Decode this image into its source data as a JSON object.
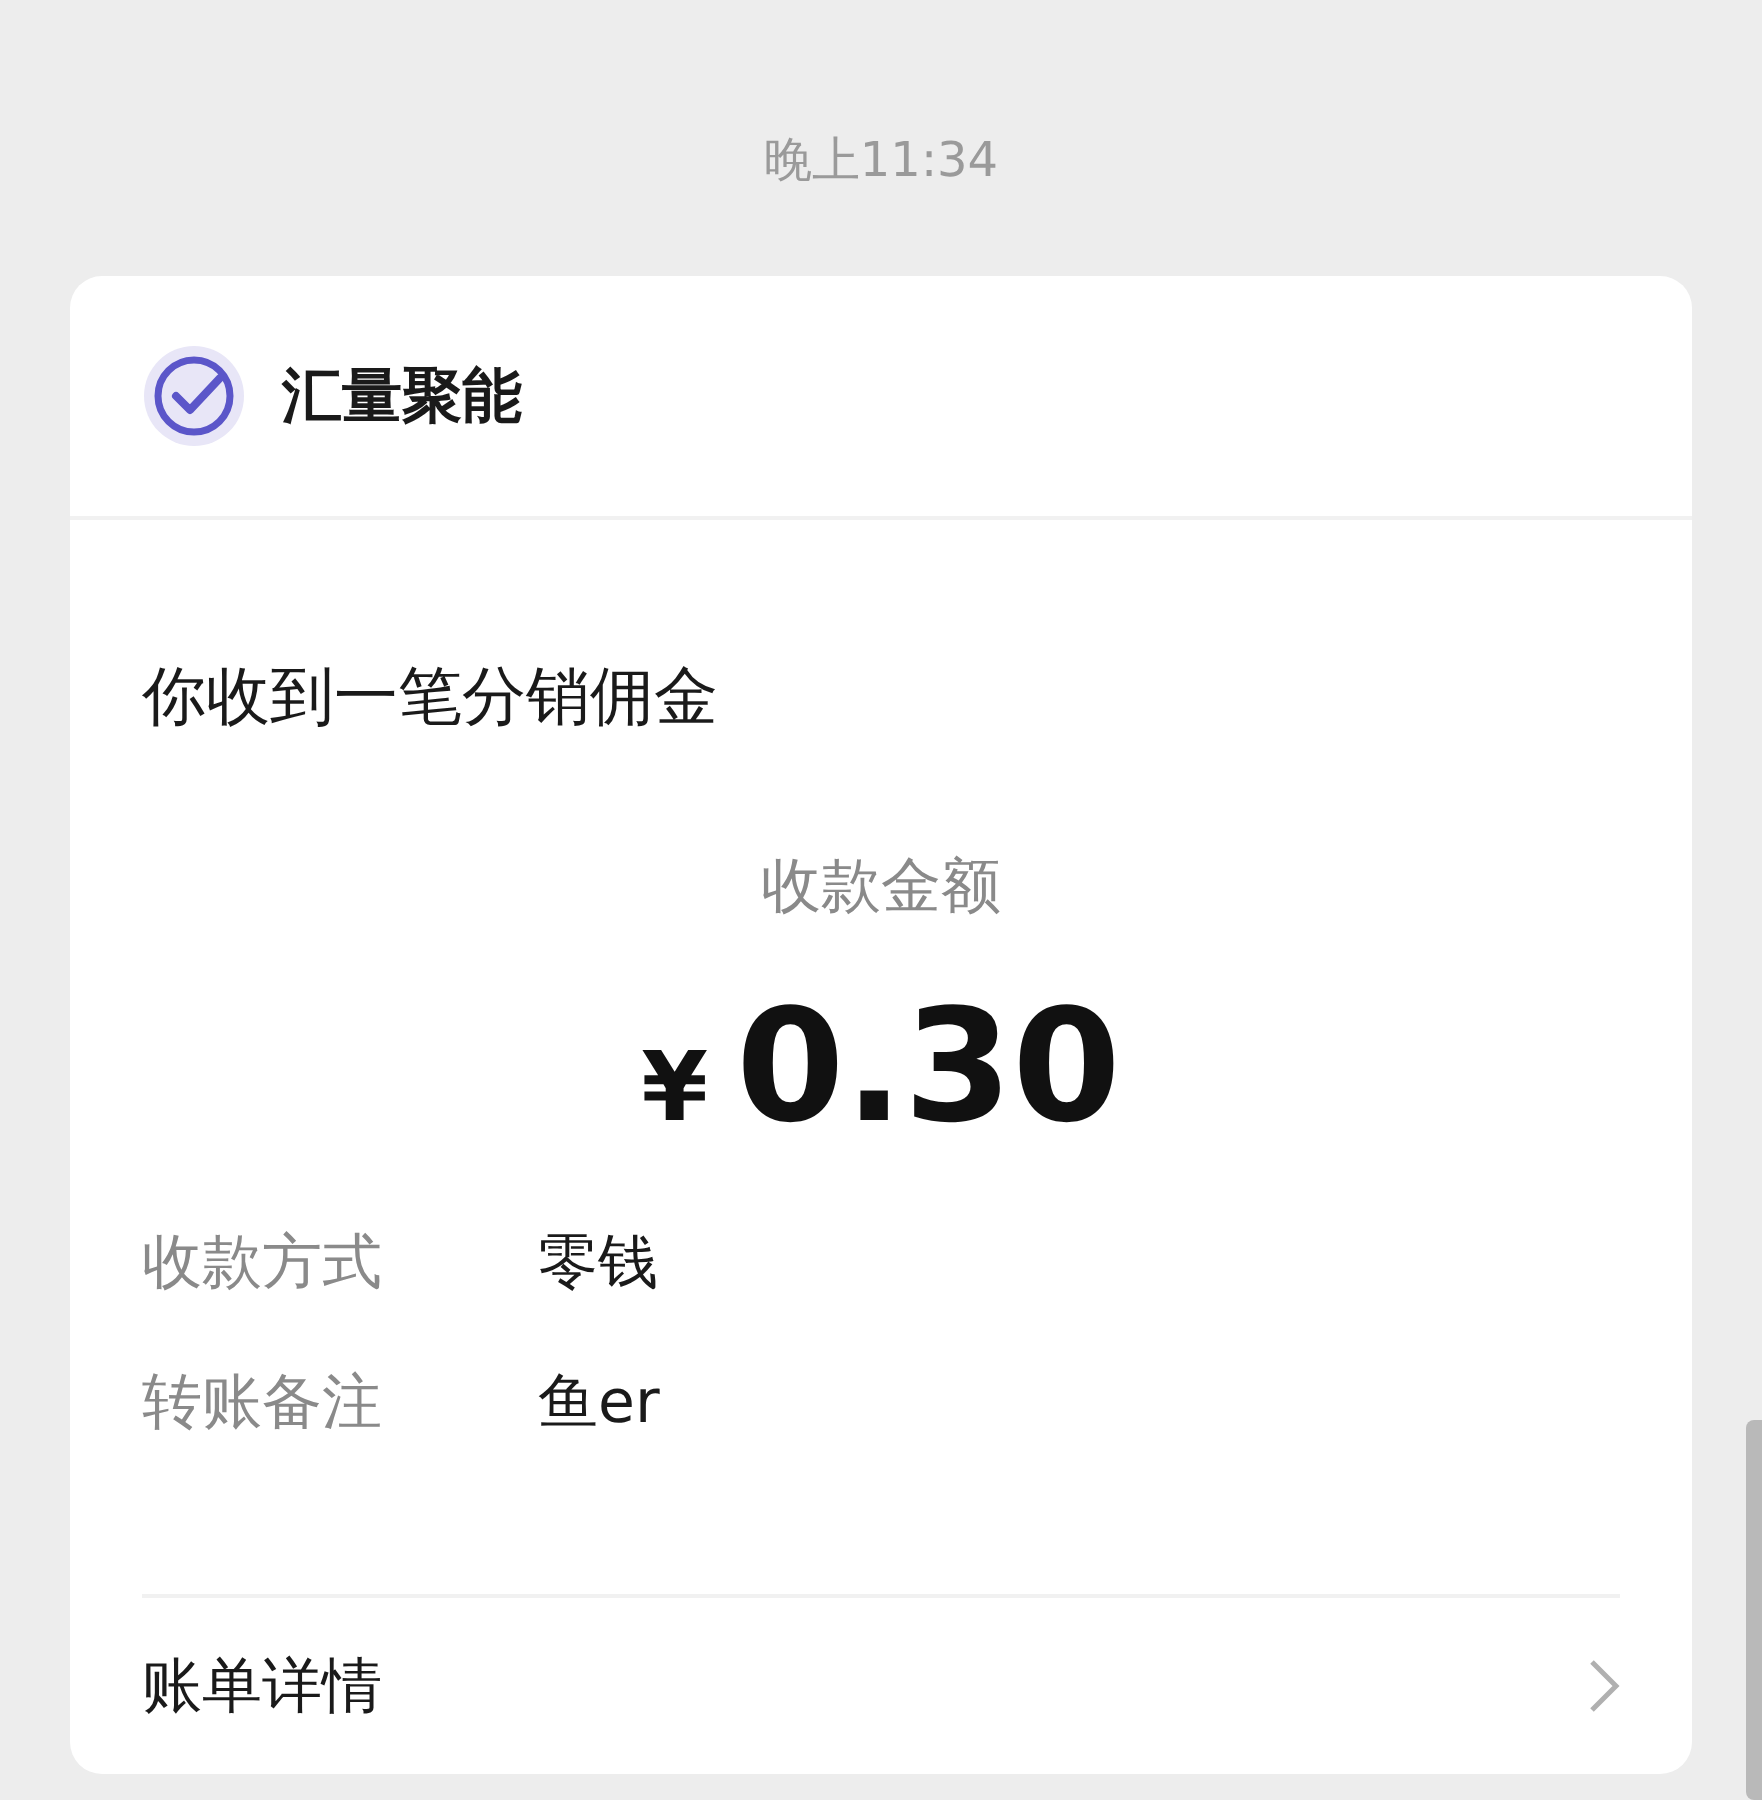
{
  "time": "晚上11:34",
  "card": {
    "app_name": "汇量聚能",
    "title": "你收到一笔分销佣金",
    "amount_label": "收款金额",
    "currency": "¥",
    "amount": "0.30",
    "details": [
      {
        "label": "收款方式",
        "value": "零钱"
      },
      {
        "label": "转账备注",
        "value": "鱼er"
      }
    ],
    "footer_link": "账单详情"
  }
}
